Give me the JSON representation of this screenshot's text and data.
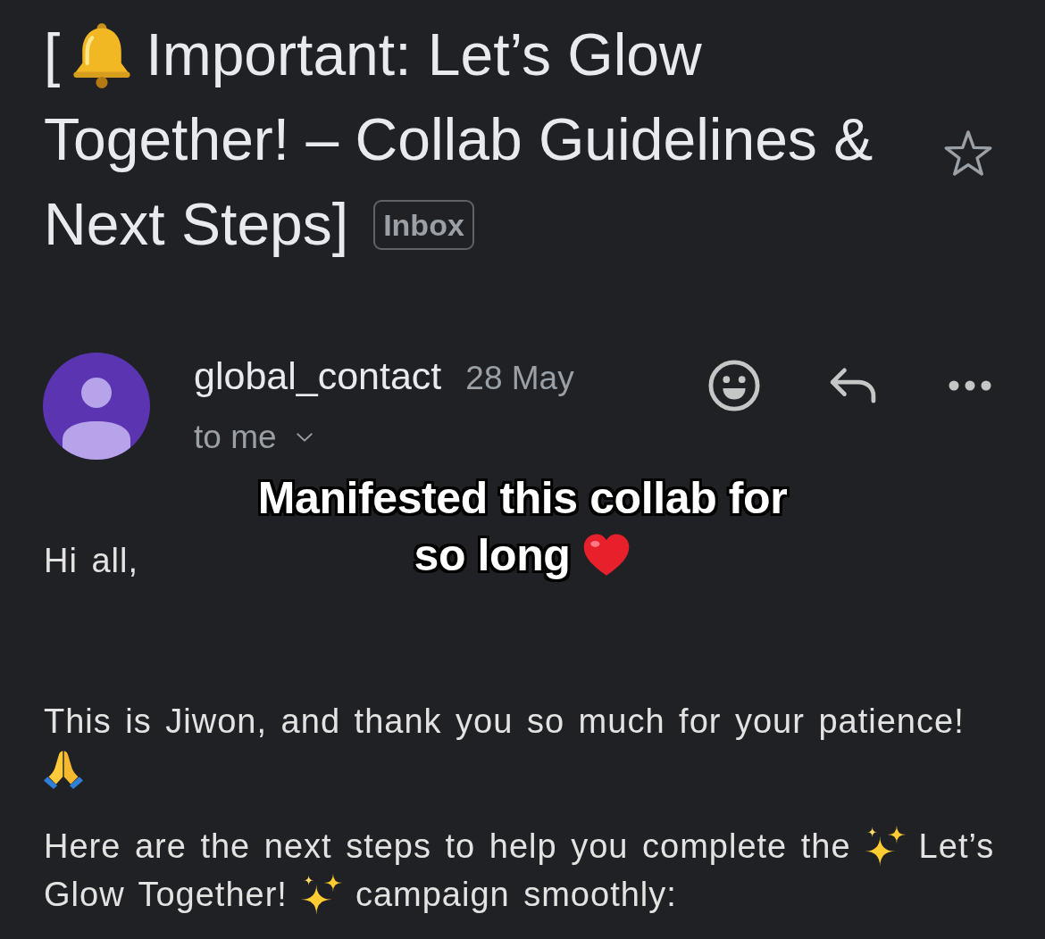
{
  "header": {
    "subject_lines": [
      [
        {
          "kind": "text",
          "text": "["
        },
        {
          "kind": "bell"
        },
        {
          "kind": "text",
          "text": "Important: Let’s Glow"
        }
      ],
      [
        {
          "kind": "text",
          "text": "Together! – Collab Guidelines &"
        }
      ],
      [
        {
          "kind": "text",
          "text": "Next Steps]"
        },
        {
          "kind": "label",
          "text": "Inbox"
        }
      ]
    ],
    "starred": false
  },
  "message": {
    "sender": "global_contact",
    "date": "28 May",
    "recipients": "to me"
  },
  "body": {
    "paragraphs": [
      {
        "lines": [
          [
            {
              "kind": "text",
              "text": "Hi all,"
            }
          ]
        ]
      },
      {
        "lines": [
          [
            {
              "kind": "text",
              "text": "This is Jiwon, and thank you so much for your patience!"
            }
          ],
          [
            {
              "kind": "pray"
            }
          ]
        ]
      },
      {
        "lines": [
          [
            {
              "kind": "text",
              "text": "Here are the next steps to help you complete the"
            },
            {
              "kind": "sparkles"
            },
            {
              "kind": "text",
              "text": "Let’s"
            }
          ],
          [
            {
              "kind": "text",
              "text": "Glow Together!"
            },
            {
              "kind": "sparkles"
            },
            {
              "kind": "text",
              "text": "campaign smoothly:"
            }
          ]
        ]
      }
    ]
  },
  "caption": {
    "lines": [
      [
        {
          "kind": "text",
          "text": "Manifested this collab for"
        }
      ],
      [
        {
          "kind": "text",
          "text": "so long"
        },
        {
          "kind": "heart"
        }
      ]
    ]
  }
}
